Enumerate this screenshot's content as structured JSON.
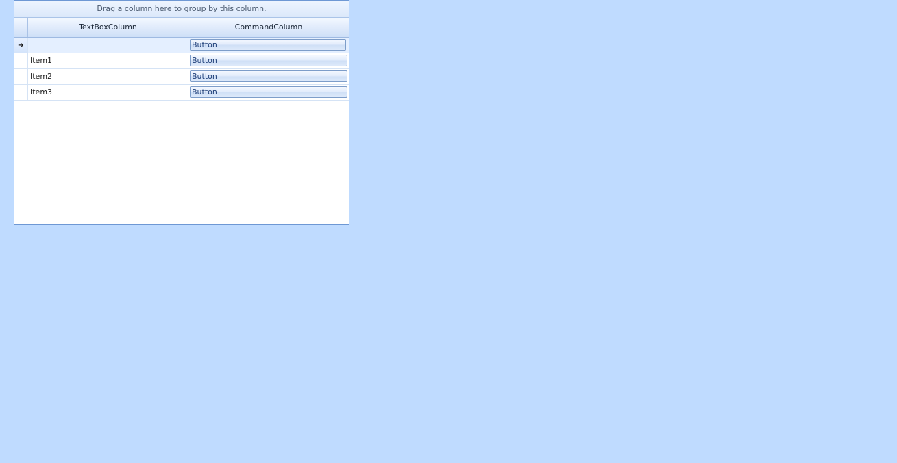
{
  "grid": {
    "group_panel_text": "Drag a column here to group by this column.",
    "columns": [
      "TextBoxColumn",
      "CommandColumn"
    ],
    "current_row_indicator": "➔",
    "rows": [
      {
        "text": "",
        "command": "Button"
      },
      {
        "text": "Item1",
        "command": "Button"
      },
      {
        "text": "Item2",
        "command": "Button"
      },
      {
        "text": "Item3",
        "command": "Button"
      }
    ]
  },
  "colors": {
    "background": "#bfdbff",
    "grid_border": "#6e98d4",
    "button_text": "#1f3f78"
  }
}
